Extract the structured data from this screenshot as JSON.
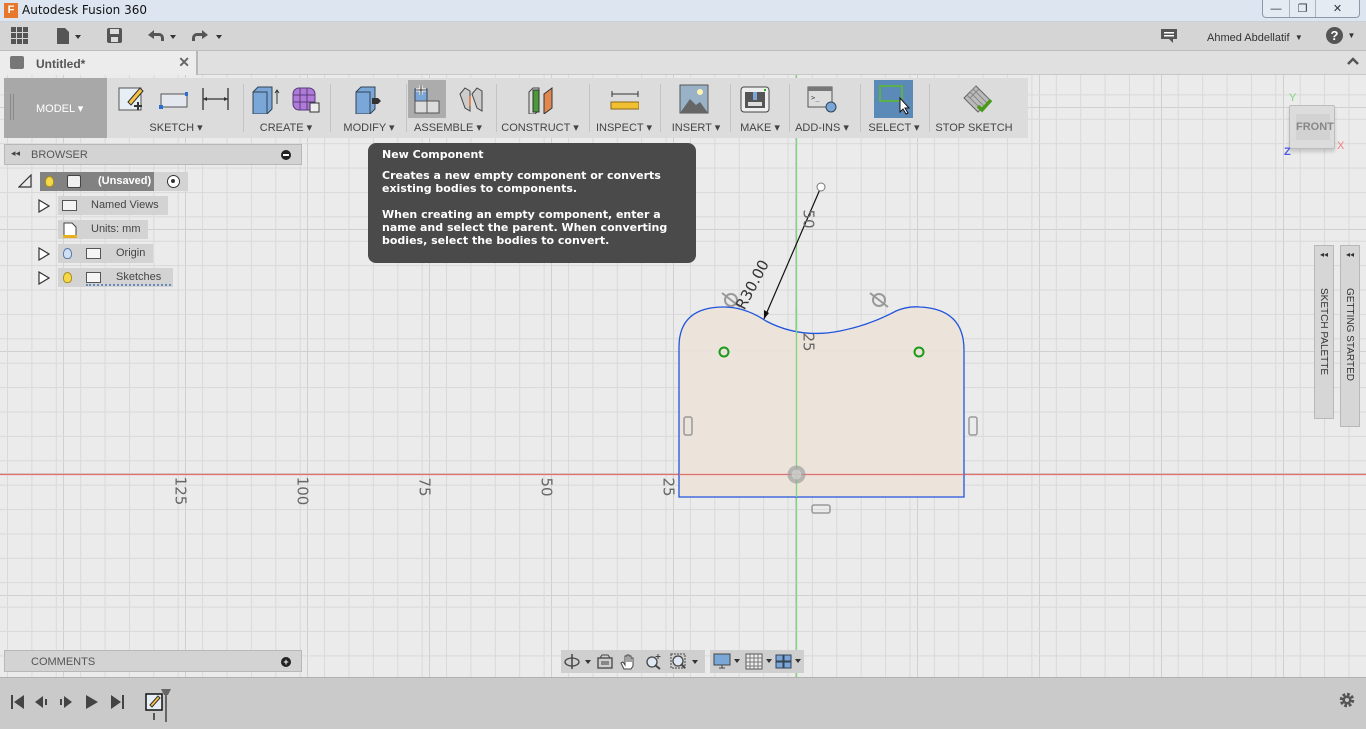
{
  "window": {
    "title": "Autodesk Fusion 360",
    "app_icon": "F",
    "controls": {
      "minimize": "—",
      "restore": "❐",
      "close": "✕"
    }
  },
  "quick_access": {
    "user_name": "Ahmed Abdellatif",
    "help_label": "?"
  },
  "tab": {
    "label": "Untitled*",
    "close": "✕"
  },
  "ribbon": {
    "workspace": "MODEL ▾",
    "groups": [
      {
        "label": "SKETCH ▾"
      },
      {
        "label": "CREATE ▾"
      },
      {
        "label": "MODIFY ▾"
      },
      {
        "label": "ASSEMBLE ▾"
      },
      {
        "label": "CONSTRUCT ▾"
      },
      {
        "label": "INSPECT ▾"
      },
      {
        "label": "INSERT ▾"
      },
      {
        "label": "MAKE ▾"
      },
      {
        "label": "ADD-INS ▾"
      },
      {
        "label": "SELECT ▾"
      },
      {
        "label": "STOP SKETCH"
      }
    ]
  },
  "browser": {
    "title": "BROWSER",
    "collapse": "◂◂",
    "items": [
      {
        "label": "(Unsaved)"
      },
      {
        "label": "Named Views"
      },
      {
        "label": "Units: mm"
      },
      {
        "label": "Origin"
      },
      {
        "label": "Sketches"
      }
    ]
  },
  "tooltip": {
    "title": "New Component",
    "para1": "Creates a new empty component or converts existing bodies to components.",
    "para2": "When creating an empty component, enter a name and select the parent. When converting bodies, select the bodies to convert."
  },
  "viewcube": {
    "face": "FRONT",
    "axis_y": "Y",
    "axis_x": "X",
    "axis_z": "Z"
  },
  "side_panels": {
    "sketch_palette": "SKETCH PALETTE",
    "getting_started": "GETTING STARTED",
    "arrow": "◂◂"
  },
  "sketch": {
    "dimension_radius": "R30.00",
    "axis_ticks_horizontal": [
      "125",
      "100",
      "75",
      "50",
      "25"
    ],
    "axis_ticks_vertical": [
      "50",
      "25"
    ],
    "colors": {
      "profile_fill": "#ece3d8",
      "profile_edge": "#2255dd",
      "x_axis": "#e07070",
      "y_axis": "#7fd67f",
      "point": "#1a9a1a"
    }
  },
  "comments": {
    "title": "COMMENTS",
    "add": "+"
  }
}
